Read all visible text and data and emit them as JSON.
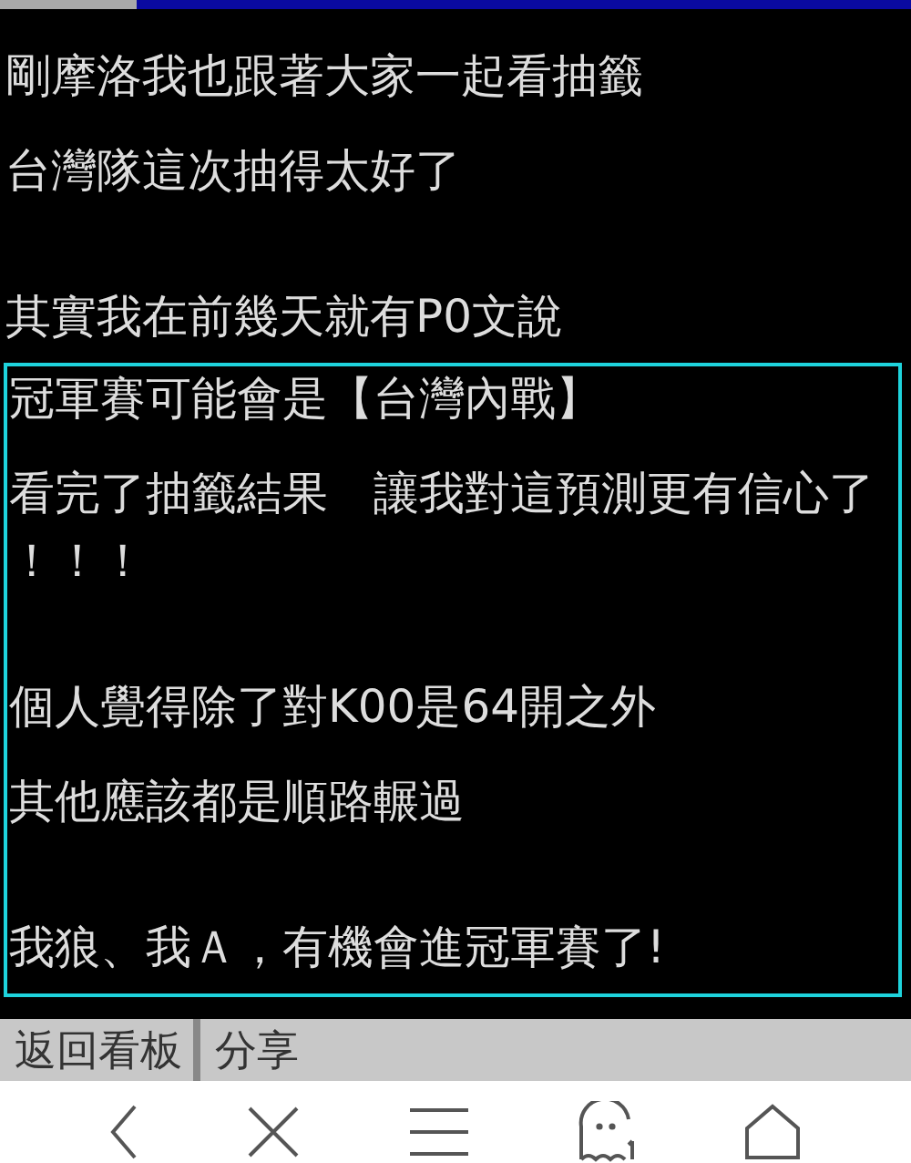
{
  "paragraphs": [
    [
      [
        "剛摩洛我也跟著大家一起看抽籤"
      ],
      [
        "台灣隊這次抽得太好了"
      ]
    ],
    [
      [
        "其實我在前幾天就有P0文說"
      ]
    ]
  ],
  "highlight_box": {
    "paragraphs": [
      [
        [
          "冠軍賽可能會是【台灣內戰】"
        ],
        [
          "看完了抽籤結果　讓我對這預測更有信心了",
          "！！！"
        ]
      ],
      [
        [
          "個人覺得除了對K00是64開之外"
        ],
        [
          "其他應該都是順路輾過"
        ]
      ],
      [
        [
          "我狼、我Ａ，有機會進冠軍賽了!"
        ]
      ]
    ]
  },
  "bottom_bar": {
    "buttons": [
      "返回看板",
      "分享"
    ]
  },
  "nav_bar": {
    "buttons": [
      {
        "kind": "back"
      },
      {
        "kind": "close"
      },
      {
        "kind": "menu"
      },
      {
        "kind": "ghost"
      },
      {
        "kind": "home"
      }
    ]
  }
}
